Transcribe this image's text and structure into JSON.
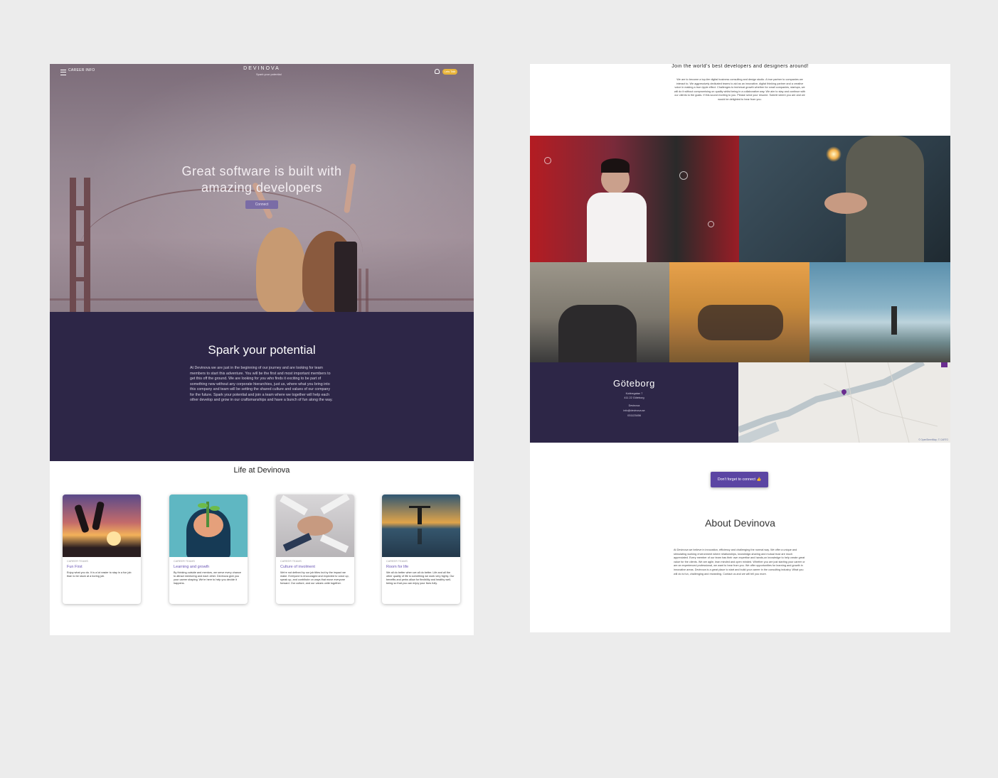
{
  "left_page": {
    "nav": {
      "career_label": "CAREER INFO",
      "brand": "DEVINOVA",
      "brand_tagline": "Spark your potential",
      "connect_label": "Lets Talk"
    },
    "hero": {
      "title_line1": "Great software is built with",
      "title_line2": "amazing developers",
      "button": "Connect"
    },
    "spark": {
      "title": "Spark your potential",
      "text": "At Devinova we are just in the beginning of our journey and are looking for team members to start this adventure. You will be the first and most important members to get this off the ground. We are looking for you who finds it exciting to be part of something new without any corporate hierarchies, just us, where what you bring into this company and team will be setting the shared culture and values of our company for the future. Spark your potential and join a team where we together will help each other develop and grow in our craftsmanships and have a bunch of fun along the way."
    },
    "life": {
      "title": "Life at Devinova",
      "cards": [
        {
          "tag": "CAREER TEAMS",
          "title": "Fun First",
          "text": "Enjoy what you do. It is a lot easier to stay in a fun job than to be stuck at a boring job."
        },
        {
          "tag": "CAREER TEAMS",
          "title": "Learning and growth",
          "text": "By thinking outside and mentors, we serve every chance to attract mentoring and each other. Devinova give you your career shaping. We're here to help you decide it happens."
        },
        {
          "tag": "CAREER TEAMS",
          "title": "Culture of involment",
          "text": "We're not defined by our job titles but by the impact we make. Everyone is encouraged and expected to voice up, speak up, and contribute on ways that move everyone forward. Our culture, and our values unite together."
        },
        {
          "tag": "CAREER TEAMS",
          "title": "Room for life",
          "text": "We all do better when we all do better. Life and all the other quality of life is something we work very highly. Our benefits and perks allow for flexibility and healthy well-being so that you can enjoy your lives fully."
        }
      ]
    }
  },
  "right_page": {
    "join": {
      "title": "Join the world's best developers and designers around!",
      "text": "We are to become a top-tier digital business consulting and design studio. A true partner to companies we interact to. We aggressively dedicated teams to aid as an innovative, digital thinking partner and a creative voice in making a true ripple effect. Challenges to technical growth whether for small companies, startups, we will do it without compromising on quality whilst being in a collaborative way. We aim to stay and continue with our clients to the goals. If this sound exciting to you. Please send your resume. Submit where you are and we would be delighted to hear from you."
    },
    "city": {
      "name": "Göteborg",
      "address1": "Kobbegatan 7",
      "address2": "411 22 Göteborg",
      "label": "Devinova",
      "email": "info@devinova.se",
      "phone": "031123456"
    },
    "map": {
      "attribution": "© OpenStreetMap, © CARTO"
    },
    "cta": "Don't forget to connect 👍",
    "about": {
      "title": "About Devinova",
      "text": "At Devinova we believe in innovation, efficiency and challenging the normal way. We offer a unique and stimulating working environment where relationships, knowledge-sharing and mutual trust are much appreciated. Every member of our team has their own expertise and hands-on knowledge to help create great value for the clients. We are agile, lean minded and open minded. Whether you are just starting your career or are an experienced professional, we want to hear from you. We offer opportunities for learning and growth in innovative areas. Devinova is a great place to start and build your career in the consulting industry. What you will do is fun, challenging and rewarding. Contact us and we will tell you more."
    }
  }
}
